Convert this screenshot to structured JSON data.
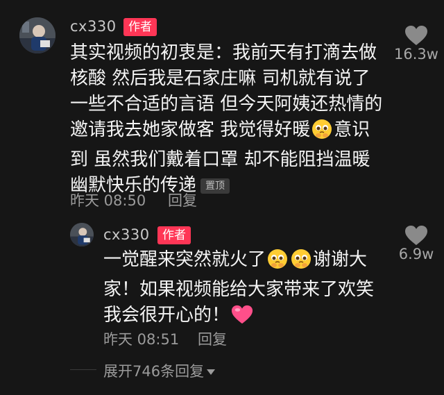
{
  "comment": {
    "username": "cx330",
    "author_badge": "作者",
    "lines": [
      "其实视频的初衷是：我前天有打滴去做",
      "核酸 然后我是石家庄嘛 司机就有说了",
      "一些不合适的言语 但今天阿姨还热情的",
      "邀请我去她家做客 我觉得好暖",
      "意识",
      "到 虽然我们戴着口罩 却不能阻挡温暖",
      "幽默快乐的传递"
    ],
    "pinned_label": "置顶",
    "time": "昨天 08:50",
    "reply_label": "回复",
    "like_count": "16.3w",
    "emoji_icon": "pleading-face-icon"
  },
  "reply": {
    "username": "cx330",
    "author_badge": "作者",
    "lines": [
      "一觉醒来突然就火了",
      "谢谢大",
      "家！如果视频能给大家带来了欢笑",
      "我会很开心的！"
    ],
    "time": "昨天 08:51",
    "reply_label": "回复",
    "like_count": "6.9w",
    "heart_icon": "pink-heart-icon"
  },
  "expand_replies": "展开746条回复",
  "colors": {
    "badge": "#ff3656",
    "background": "#161616",
    "heart": "#ff4f8a"
  }
}
